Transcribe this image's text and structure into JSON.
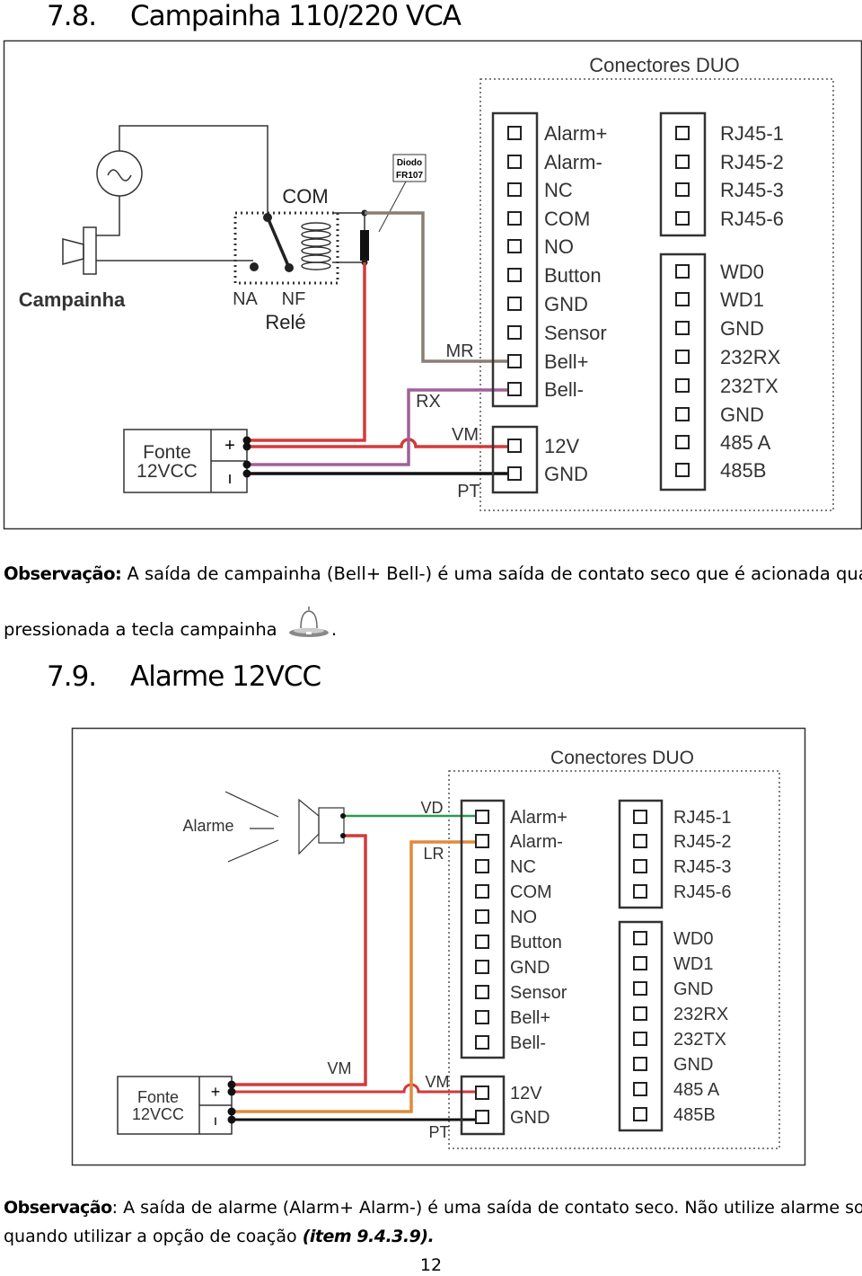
{
  "section1": {
    "number": "7.8.",
    "title": "Campainha 110/220 VCA",
    "diagram": {
      "connectors_title": "Conectores DUO",
      "block_a": [
        "Alarm+",
        "Alarm-",
        "NC",
        "COM",
        "NO",
        "Button",
        "GND",
        "Sensor",
        "Bell+",
        "Bell-"
      ],
      "block_b": [
        "12V",
        "GND"
      ],
      "block_c": [
        "RJ45-1",
        "RJ45-2",
        "RJ45-3",
        "RJ45-6"
      ],
      "block_d": [
        "WD0",
        "WD1",
        "GND",
        "232RX",
        "232TX",
        "GND",
        "485 A",
        "485B"
      ],
      "bell_label": "Campainha",
      "relay_label": "Relé",
      "com_label": "COM",
      "na_label": "NA",
      "nf_label": "NF",
      "diode_label_1": "Diodo",
      "diode_label_2": "FR107",
      "psu_label_1": "Fonte",
      "psu_label_2": "12VCC",
      "psu_plus": "+",
      "psu_minus": "ı",
      "wire_mr": "MR",
      "wire_rx": "RX",
      "wire_vm": "VM",
      "wire_pt": "PT",
      "wire_colors": {
        "mr": "#8a7d74",
        "rx": "#a0609a",
        "vm": "#d23a3a",
        "pt": "#111111"
      }
    },
    "note_label": "Observação:",
    "note_line1": "A saída de campainha (Bell+ Bell-) é uma saída de contato seco que é acionada quando",
    "note_line2": "pressionada a tecla campainha",
    "note_end": ".",
    "note_icon": "bell-icon"
  },
  "section2": {
    "number": "7.9.",
    "title": "Alarme 12VCC",
    "diagram": {
      "connectors_title": "Conectores DUO",
      "block_a": [
        "Alarm+",
        "Alarm-",
        "NC",
        "COM",
        "NO",
        "Button",
        "GND",
        "Sensor",
        "Bell+",
        "Bell-"
      ],
      "block_b": [
        "12V",
        "GND"
      ],
      "block_c": [
        "RJ45-1",
        "RJ45-2",
        "RJ45-3",
        "RJ45-6"
      ],
      "block_d": [
        "WD0",
        "WD1",
        "GND",
        "232RX",
        "232TX",
        "GND",
        "485 A",
        "485B"
      ],
      "alarm_label": "Alarme",
      "psu_label_1": "Fonte",
      "psu_label_2": "12VCC",
      "psu_plus": "+",
      "psu_minus": "ı",
      "wire_vd": "VD",
      "wire_lr": "LR",
      "wire_vm": "VM",
      "wire_pt": "PT",
      "wire_colors": {
        "vd": "#2e9a57",
        "lr": "#e08a3c",
        "vm": "#d23a3a",
        "pt": "#111111"
      }
    },
    "note_label": "Observação",
    "note_line1": ": A saída de alarme (Alarm+ Alarm-) é uma saída de contato seco. Não utilize alarme sonoro",
    "note_line2": "quando utilizar a opção de coação",
    "note_ref": "(item 9.4.3.9)."
  },
  "page_number": "12"
}
